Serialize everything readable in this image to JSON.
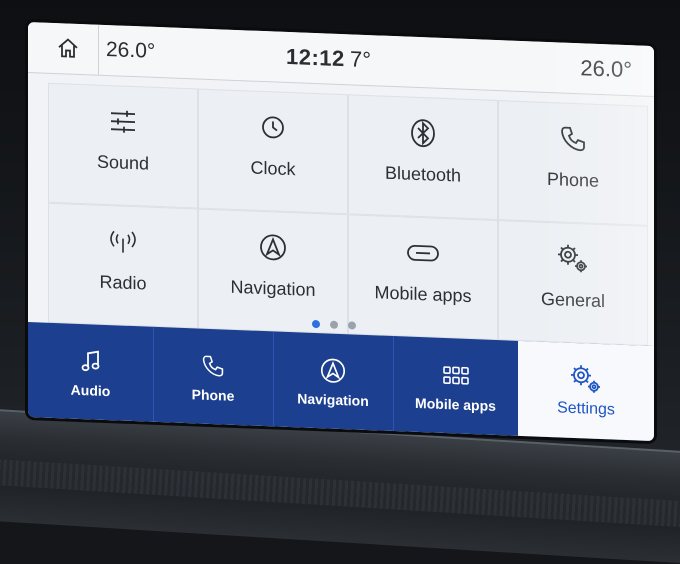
{
  "status_bar": {
    "temp_left": "26.0°",
    "time": "12:12",
    "outside_temp": "7°",
    "temp_right": "26.0°"
  },
  "tiles": [
    {
      "label": "Sound",
      "icon": "sliders-icon"
    },
    {
      "label": "Clock",
      "icon": "clock-icon"
    },
    {
      "label": "Bluetooth",
      "icon": "bluetooth-icon"
    },
    {
      "label": "Phone",
      "icon": "phone-icon"
    },
    {
      "label": "Radio",
      "icon": "radio-antenna-icon"
    },
    {
      "label": "Navigation",
      "icon": "navigation-arrow-icon"
    },
    {
      "label": "Mobile apps",
      "icon": "link-pill-icon"
    },
    {
      "label": "General",
      "icon": "gears-icon"
    }
  ],
  "pager": {
    "pages": 3,
    "current": 1
  },
  "nav": [
    {
      "label": "Audio",
      "icon": "music-note-icon"
    },
    {
      "label": "Phone",
      "icon": "phone-icon"
    },
    {
      "label": "Navigation",
      "icon": "navigation-arrow-icon"
    },
    {
      "label": "Mobile apps",
      "icon": "app-grid-icon"
    },
    {
      "label": "Settings",
      "icon": "gears-icon",
      "active": true
    }
  ],
  "colors": {
    "nav_background": "#1d3f8f",
    "active_accent": "#1f55c4",
    "screen_background": "#f1f3f6"
  }
}
